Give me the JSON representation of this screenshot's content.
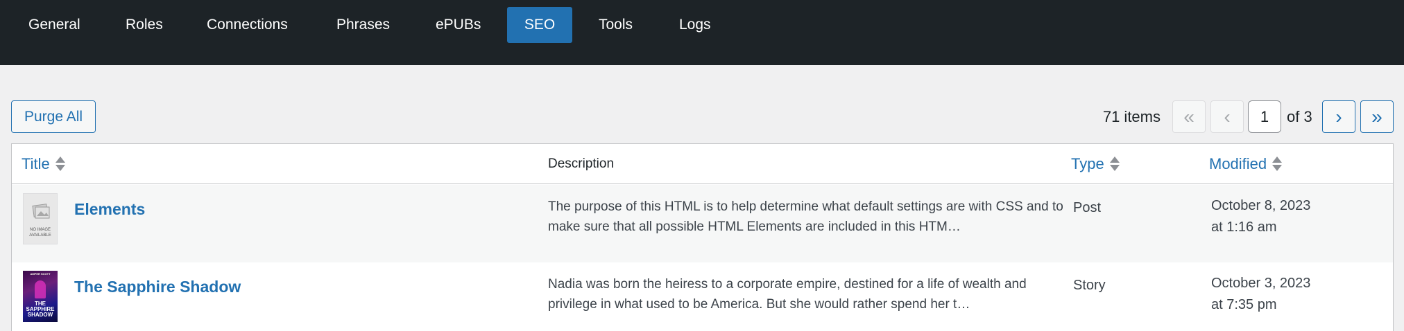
{
  "nav": {
    "tabs": [
      {
        "label": "General",
        "active": false
      },
      {
        "label": "Roles",
        "active": false
      },
      {
        "label": "Connections",
        "active": false
      },
      {
        "label": "Phrases",
        "active": false
      },
      {
        "label": "ePUBs",
        "active": false
      },
      {
        "label": "SEO",
        "active": true
      },
      {
        "label": "Tools",
        "active": false
      },
      {
        "label": "Logs",
        "active": false
      }
    ]
  },
  "toolbar": {
    "purge_label": "Purge All",
    "items_count": "71 items",
    "first_page": "«",
    "prev_page": "‹",
    "current_page": "1",
    "of_total": "of 3",
    "next_page": "›",
    "last_page": "»"
  },
  "table": {
    "headers": {
      "title": "Title",
      "description": "Description",
      "type": "Type",
      "modified": "Modified"
    },
    "rows": [
      {
        "title": "Elements",
        "thumbnail": "no-image-placeholder",
        "thumbnail_text": "NO IMAGE AVAILABLE",
        "description": "The purpose of this HTML is to help determine what default settings are with CSS and to make sure that all possible HTML Elements are included in this HTM…",
        "type": "Post",
        "modified_date": "October 8, 2023",
        "modified_time": "at 1:16 am"
      },
      {
        "title": "The Sapphire Shadow",
        "thumbnail": "book-cover",
        "thumbnail_author": "AMPER SCOTT",
        "thumbnail_title": "THE SAPPHIRE SHADOW",
        "description": "Nadia was born the heiress to a corporate empire, destined for a life of wealth and privilege in what used to be America. But she would rather spend her t…",
        "type": "Story",
        "modified_date": "October 3, 2023",
        "modified_time": "at 7:35 pm"
      }
    ]
  },
  "colors": {
    "nav_bg": "#1d2327",
    "accent": "#2271b1",
    "page_bg": "#f0f0f1"
  }
}
